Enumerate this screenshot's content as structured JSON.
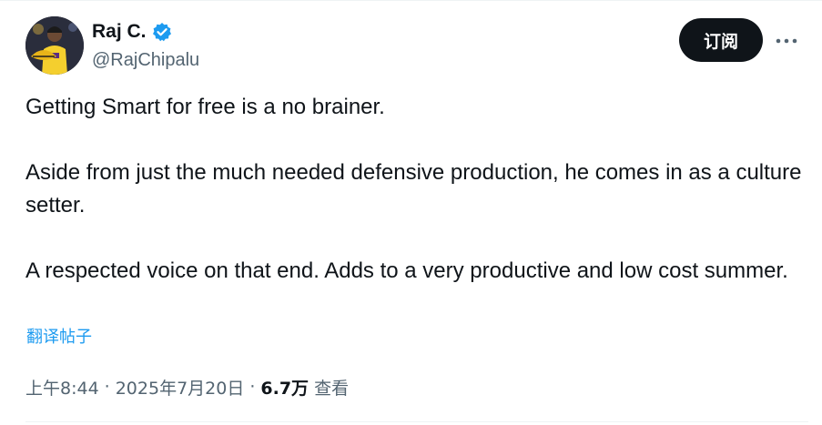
{
  "author": {
    "display_name": "Raj C.",
    "handle": "@RajChipalu",
    "verified_color": "#1d9bf0"
  },
  "actions": {
    "subscribe_label": "订阅",
    "more_icon": "more-horizontal-icon"
  },
  "tweet": {
    "paragraphs": [
      "Getting Smart for free is a no brainer.",
      "Aside from just the much needed defensive production, he comes in as a culture setter.",
      "A respected voice on that end. Adds to a very productive and low cost summer."
    ],
    "translate_label": "翻译帖子"
  },
  "meta": {
    "time": "上午8:44",
    "separator": "·",
    "date": "2025年7月20日",
    "views_count": "6.7万",
    "views_label": "查看"
  },
  "colors": {
    "text": "#0f1419",
    "secondary": "#536471",
    "link": "#1d9bf0",
    "button_bg": "#0f1419"
  }
}
